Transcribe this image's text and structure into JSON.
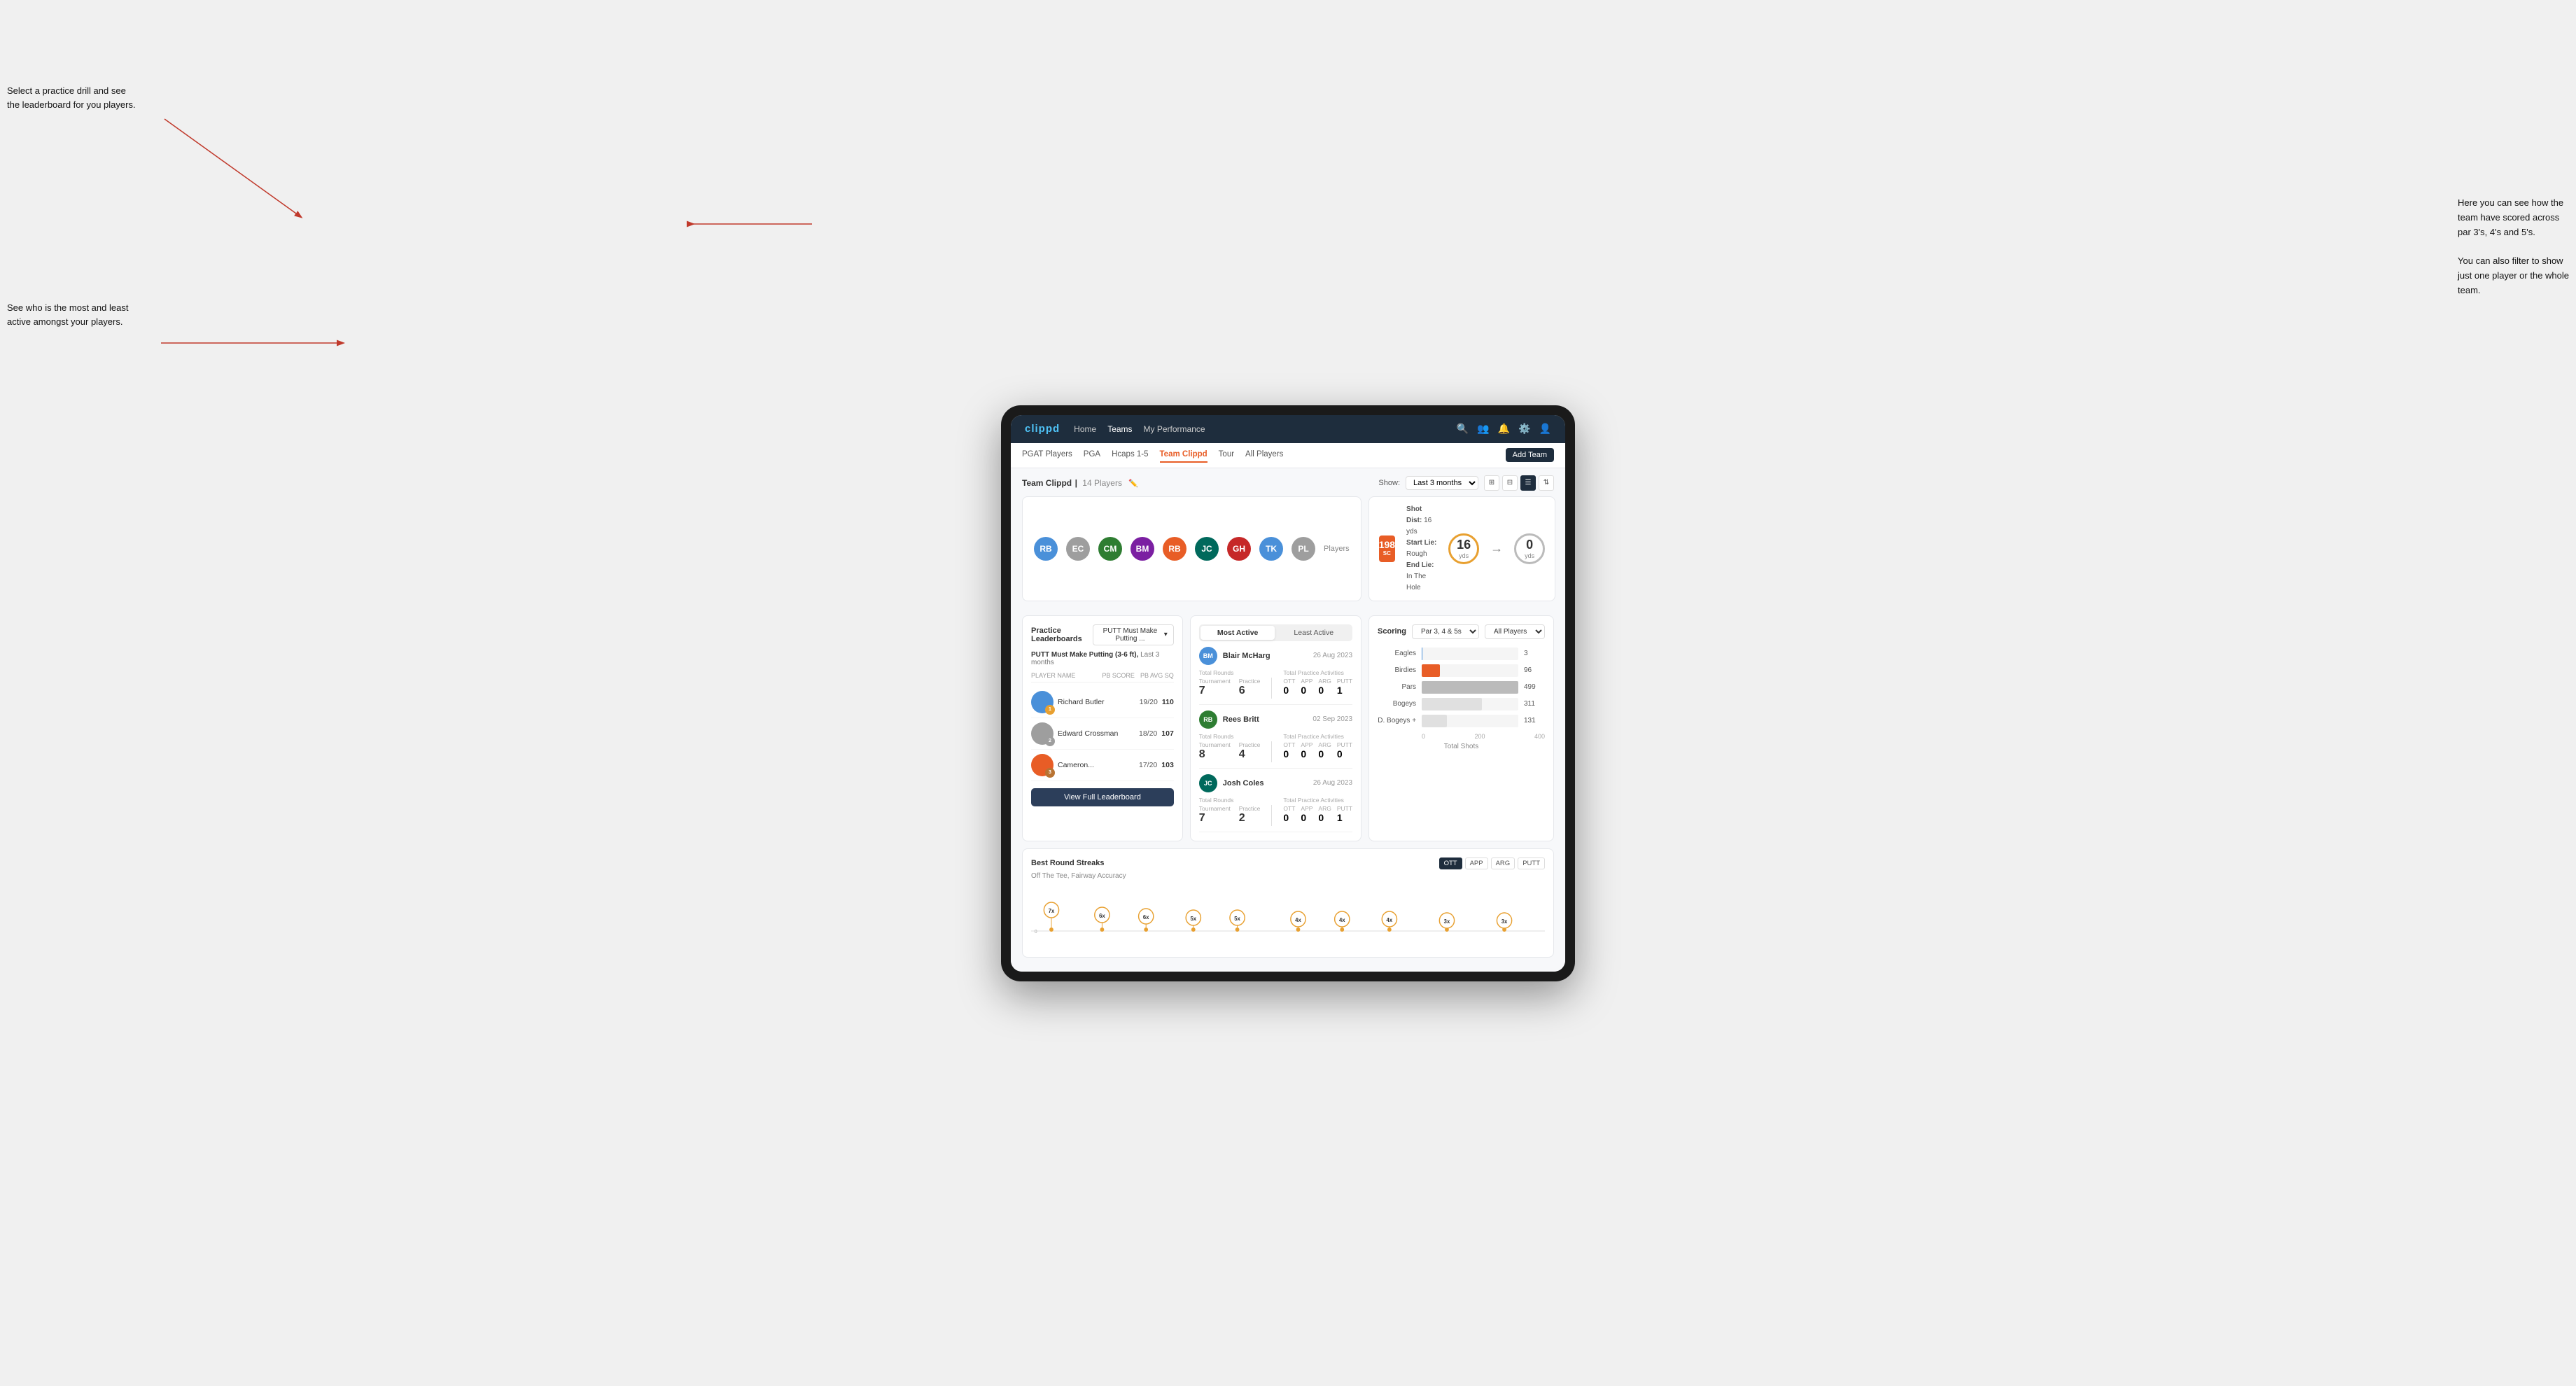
{
  "annotations": {
    "top_left": "Select a practice drill and see the leaderboard for you players.",
    "bottom_left": "See who is the most and least active amongst your players.",
    "top_right_line1": "Here you can see how the",
    "top_right_line2": "team have scored across",
    "top_right_line3": "par 3's, 4's and 5's.",
    "bottom_right_line1": "You can also filter to show",
    "bottom_right_line2": "just one player or the whole",
    "bottom_right_line3": "team."
  },
  "navbar": {
    "logo": "clippd",
    "links": [
      "Home",
      "Teams",
      "My Performance"
    ],
    "active_link": "Teams"
  },
  "subnav": {
    "links": [
      "PGAT Players",
      "PGA",
      "Hcaps 1-5",
      "Team Clippd",
      "Tour",
      "All Players"
    ],
    "active_link": "Team Clippd",
    "add_team_label": "Add Team"
  },
  "team_section": {
    "title": "Team Clippd",
    "player_count": "14 Players",
    "show_label": "Show:",
    "show_value": "Last 3 months",
    "players_label": "Players"
  },
  "shot_info": {
    "badge": "198",
    "badge_sub": "SC",
    "shot_dist_label": "Shot Dist:",
    "shot_dist_val": "16 yds",
    "start_lie_label": "Start Lie:",
    "start_lie_val": "Rough",
    "end_lie_label": "End Lie:",
    "end_lie_val": "In The Hole",
    "yardage1": "16",
    "yardage1_label": "yds",
    "yardage2": "0",
    "yardage2_label": "yds"
  },
  "practice_leaderboard": {
    "title": "Practice Leaderboards",
    "dropdown_label": "PUTT Must Make Putting ...",
    "subtitle_drill": "PUTT Must Make Putting (3-6 ft),",
    "subtitle_period": "Last 3 months",
    "col_player": "PLAYER NAME",
    "col_score": "PB SCORE",
    "col_avg": "PB AVG SQ",
    "players": [
      {
        "name": "Richard Butler",
        "score": "19/20",
        "avg": "110",
        "badge_type": "gold",
        "rank": 1
      },
      {
        "name": "Edward Crossman",
        "score": "18/20",
        "avg": "107",
        "badge_type": "silver",
        "rank": 2
      },
      {
        "name": "Cameron...",
        "score": "17/20",
        "avg": "103",
        "badge_type": "bronze",
        "rank": 3
      }
    ],
    "view_full_label": "View Full Leaderboard"
  },
  "activity": {
    "tab_most_active": "Most Active",
    "tab_least_active": "Least Active",
    "active_tab": "Most Active",
    "players": [
      {
        "name": "Blair McHarg",
        "date": "26 Aug 2023",
        "total_rounds_label": "Total Rounds",
        "tournament_label": "Tournament",
        "practice_label": "Practice",
        "tournament_val": "7",
        "practice_val": "6",
        "total_practice_label": "Total Practice Activities",
        "ott_label": "OTT",
        "app_label": "APP",
        "arg_label": "ARG",
        "putt_label": "PUTT",
        "ott_val": "0",
        "app_val": "0",
        "arg_val": "0",
        "putt_val": "1"
      },
      {
        "name": "Rees Britt",
        "date": "02 Sep 2023",
        "total_rounds_label": "Total Rounds",
        "tournament_label": "Tournament",
        "practice_label": "Practice",
        "tournament_val": "8",
        "practice_val": "4",
        "total_practice_label": "Total Practice Activities",
        "ott_label": "OTT",
        "app_label": "APP",
        "arg_label": "ARG",
        "putt_label": "PUTT",
        "ott_val": "0",
        "app_val": "0",
        "arg_val": "0",
        "putt_val": "0"
      },
      {
        "name": "Josh Coles",
        "date": "26 Aug 2023",
        "total_rounds_label": "Total Rounds",
        "tournament_label": "Tournament",
        "practice_label": "Practice",
        "tournament_val": "7",
        "practice_val": "2",
        "total_practice_label": "Total Practice Activities",
        "ott_label": "OTT",
        "app_label": "APP",
        "arg_label": "ARG",
        "putt_label": "PUTT",
        "ott_val": "0",
        "app_val": "0",
        "arg_val": "0",
        "putt_val": "1"
      }
    ]
  },
  "scoring": {
    "title": "Scoring",
    "filter1_label": "Par 3, 4 & 5s",
    "filter2_label": "All Players",
    "bars": [
      {
        "label": "Eagles",
        "value": 3,
        "max": 499,
        "type": "eagles"
      },
      {
        "label": "Birdies",
        "value": 96,
        "max": 499,
        "type": "birdies"
      },
      {
        "label": "Pars",
        "value": 499,
        "max": 499,
        "type": "pars"
      },
      {
        "label": "Bogeys",
        "value": 311,
        "max": 499,
        "type": "bogeys"
      },
      {
        "label": "D. Bogeys +",
        "value": 131,
        "max": 499,
        "type": "dbogeys"
      }
    ],
    "axis_labels": [
      "0",
      "200",
      "400"
    ],
    "total_shots_label": "Total Shots"
  },
  "best_rounds": {
    "title": "Best Round Streaks",
    "subtitle": "Off The Tee, Fairway Accuracy",
    "buttons": [
      "OTT",
      "APP",
      "ARG",
      "PUTT"
    ],
    "active_button": "OTT",
    "streaks": [
      {
        "label": "7x"
      },
      {
        "label": "6x"
      },
      {
        "label": "6x"
      },
      {
        "label": "5x"
      },
      {
        "label": "5x"
      },
      {
        "label": "4x"
      },
      {
        "label": "4x"
      },
      {
        "label": "4x"
      },
      {
        "label": "3x"
      },
      {
        "label": "3x"
      }
    ]
  },
  "players_list": {
    "avatars": [
      {
        "color": "av-blue",
        "initials": "RB"
      },
      {
        "color": "av-gray",
        "initials": "EC"
      },
      {
        "color": "av-green",
        "initials": "CM"
      },
      {
        "color": "av-purple",
        "initials": "BM"
      },
      {
        "color": "av-orange",
        "initials": "RB"
      },
      {
        "color": "av-teal",
        "initials": "JC"
      },
      {
        "color": "av-red",
        "initials": "GH"
      },
      {
        "color": "av-blue",
        "initials": "TK"
      },
      {
        "color": "av-gray",
        "initials": "PL"
      }
    ]
  }
}
